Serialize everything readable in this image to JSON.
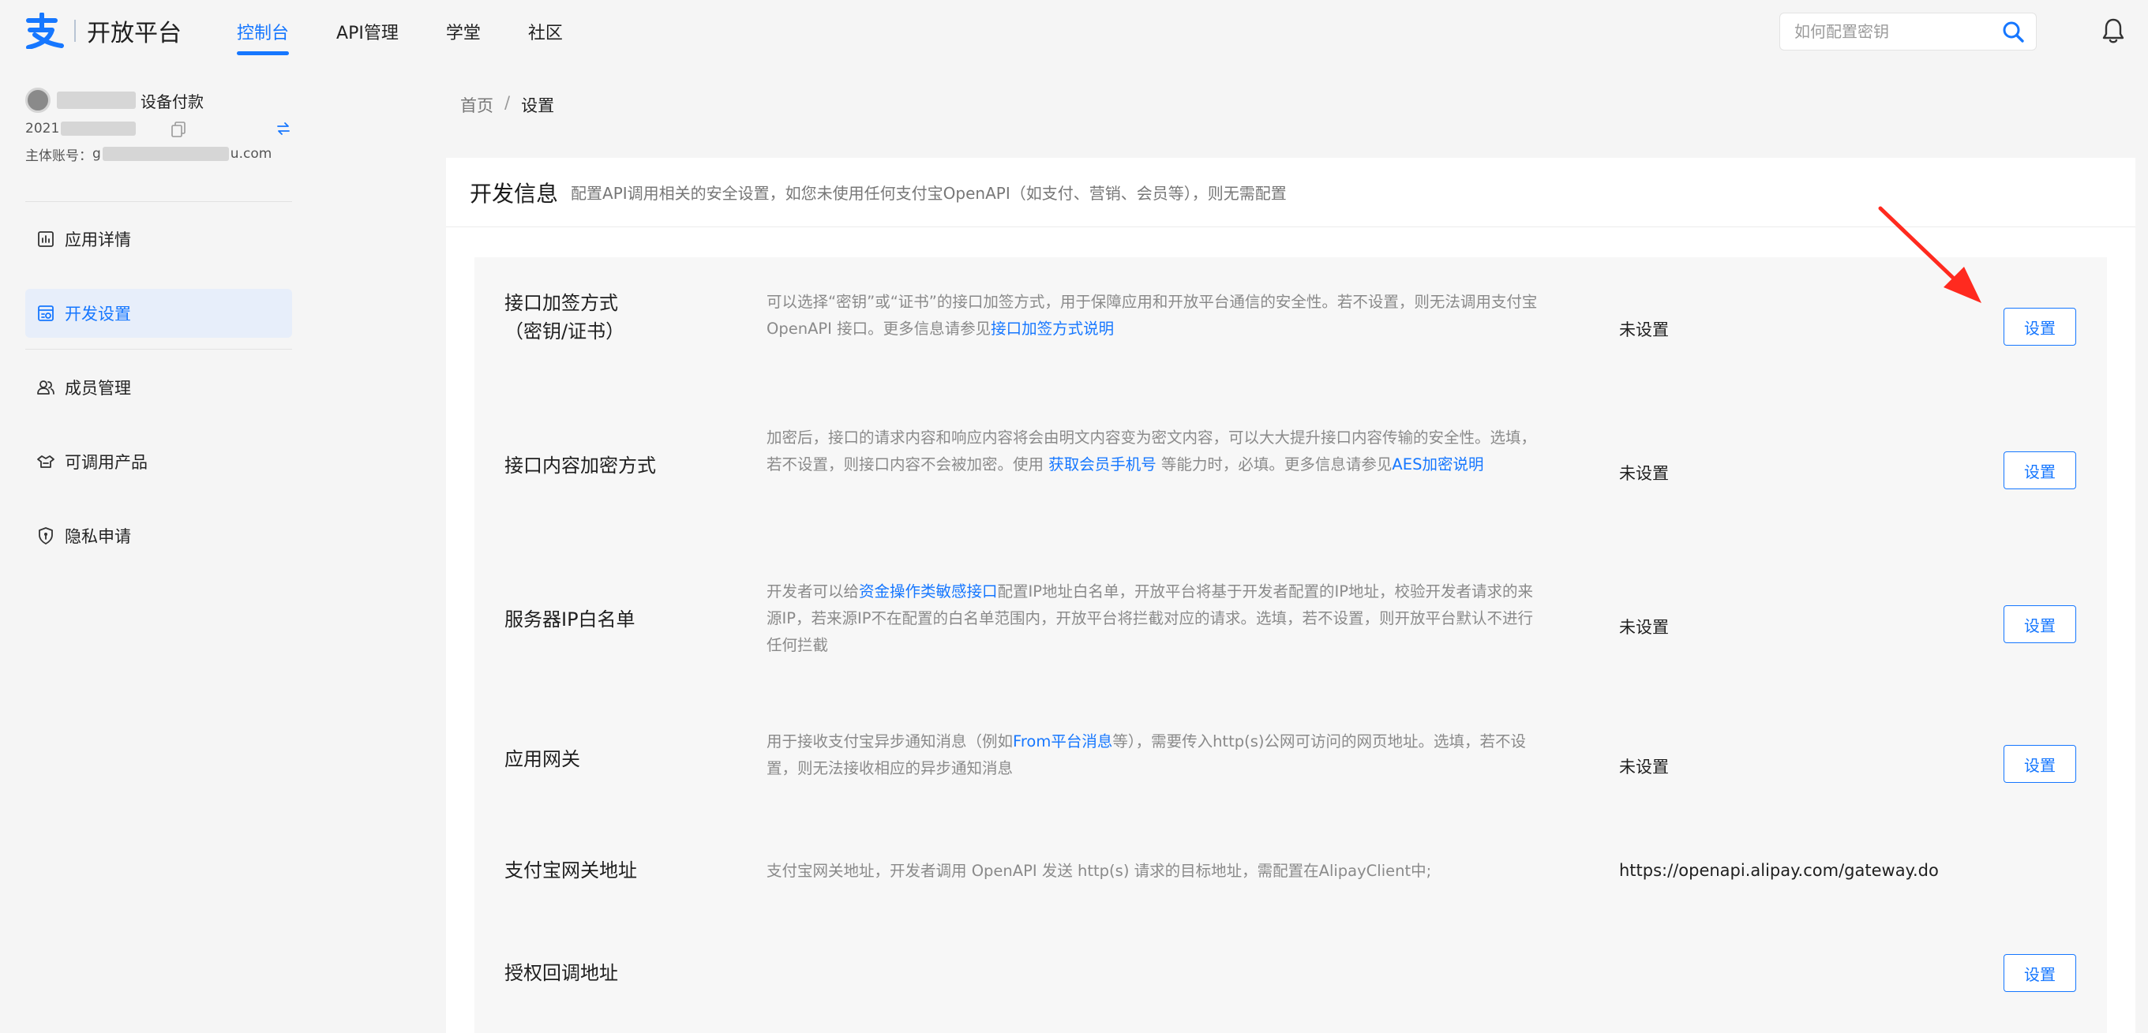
{
  "header": {
    "logo_text": "开放平台",
    "nav": [
      {
        "label": "控制台",
        "active": true
      },
      {
        "label": "API管理",
        "active": false
      },
      {
        "label": "学堂",
        "active": false
      },
      {
        "label": "社区",
        "active": false
      }
    ],
    "search_placeholder": "如何配置密钥"
  },
  "sidebar": {
    "app_name": "设备付款",
    "app_id": "2021",
    "account_label": "主体账号：",
    "account_prefix": "g",
    "account_suffix": "u.com",
    "menu": [
      {
        "label": "应用详情",
        "icon": "chart-icon",
        "active": false
      },
      {
        "label": "开发设置",
        "icon": "settings-icon",
        "active": true
      },
      {
        "label": "成员管理",
        "icon": "members-icon",
        "active": false
      },
      {
        "label": "可调用产品",
        "icon": "products-icon",
        "active": false
      },
      {
        "label": "隐私申请",
        "icon": "shield-icon",
        "active": false
      }
    ]
  },
  "breadcrumb": {
    "home": "首页",
    "separator": "/",
    "current": "设置"
  },
  "dev_info": {
    "title": "开发信息",
    "description": "配置API调用相关的安全设置，如您未使用任何支付宝OpenAPI（如支付、营销、会员等），则无需配置",
    "rows": [
      {
        "label_line1": "接口加签方式",
        "label_line2": "（密钥/证书）",
        "desc_text": "可以选择“密钥”或“证书”的接口加签方式，用于保障应用和开放平台通信的安全性。若不设置，则无法调用支付宝 OpenAPI 接口。更多信息请参见",
        "desc_link": "接口加签方式说明",
        "value": "未设置",
        "button": "设置"
      },
      {
        "label": "接口内容加密方式",
        "desc_before": "加密后，接口的请求内容和响应内容将会由明文内容变为密文内容，可以大大提升接口内容传输的安全性。选填，若不设置，则接口内容不会被加密。使用 ",
        "desc_link1": "获取会员手机号",
        "desc_middle": " 等能力时，必填。更多信息请参见",
        "desc_link2": "AES加密说明",
        "value": "未设置",
        "button": "设置"
      },
      {
        "label": "服务器IP白名单",
        "desc_before": "开发者可以给",
        "desc_link": "资金操作类敏感接口",
        "desc_after": "配置IP地址白名单，开放平台将基于开发者配置的IP地址，校验开发者请求的来源IP，若来源IP不在配置的白名单范围内，开放平台将拦截对应的请求。选填，若不设置，则开放平台默认不进行任何拦截",
        "value": "未设置",
        "button": "设置"
      },
      {
        "label": "应用网关",
        "desc_before": "用于接收支付宝异步通知消息（例如",
        "desc_link": "From平台消息",
        "desc_after": "等），需要传入http(s)公网可访问的网页地址。选填，若不设置，则无法接收相应的异步通知消息",
        "value": "未设置",
        "button": "设置"
      },
      {
        "label": "支付宝网关地址",
        "desc": "支付宝网关地址，开发者调用 OpenAPI 发送 http(s) 请求的目标地址，需配置在AlipayClient中;",
        "value": "https://openapi.alipay.com/gateway.do"
      },
      {
        "label": "授权回调地址",
        "button": "设置"
      }
    ]
  },
  "colors": {
    "accent": "#1677ff",
    "annotation_arrow": "#ff2a1f",
    "page_bg": "#f5f5f5"
  }
}
